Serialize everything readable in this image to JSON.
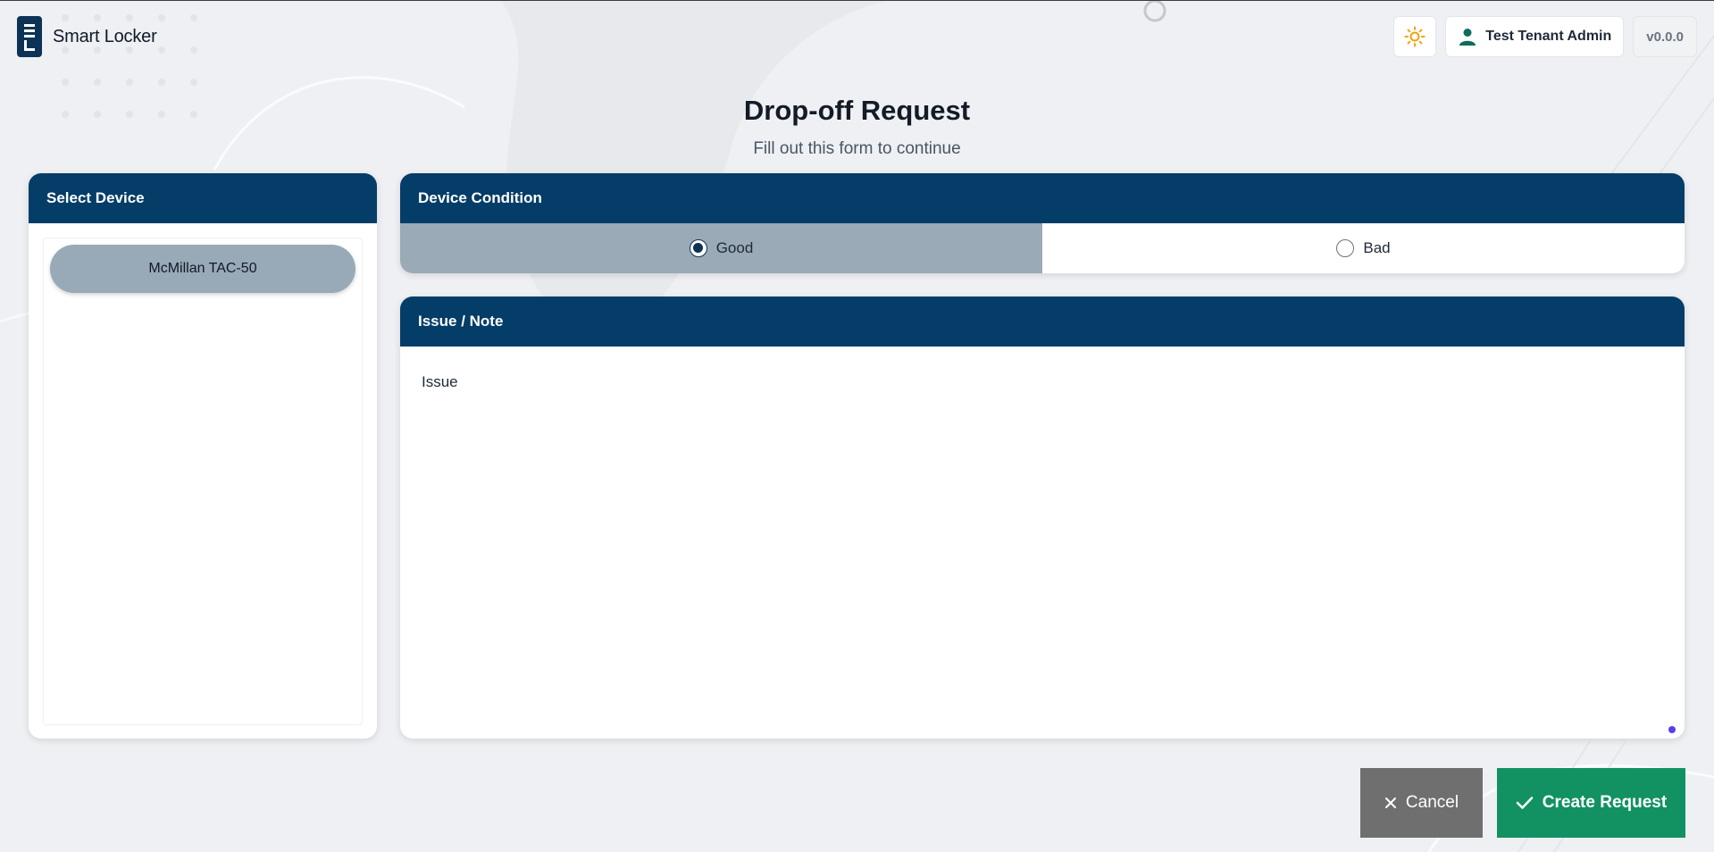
{
  "app": {
    "title": "Smart Locker"
  },
  "header": {
    "theme_icon": "sun-icon",
    "user_icon": "user-icon",
    "user_label": "Test Tenant Admin",
    "version": "v0.0.0"
  },
  "page": {
    "title": "Drop-off Request",
    "subtitle": "Fill out this form to continue"
  },
  "select_device": {
    "heading": "Select Device",
    "items": [
      {
        "label": "McMillan TAC-50",
        "selected": true
      }
    ]
  },
  "device_condition": {
    "heading": "Device Condition",
    "options": [
      {
        "label": "Good",
        "selected": true
      },
      {
        "label": "Bad",
        "selected": false
      }
    ]
  },
  "issue_note": {
    "heading": "Issue / Note",
    "value": "Issue"
  },
  "actions": {
    "cancel_label": "Cancel",
    "cancel_icon": "close-icon",
    "create_label": "Create Request",
    "create_icon": "check-icon"
  },
  "colors": {
    "primary": "#043d68",
    "selected": "#9aaab6",
    "success": "#129163",
    "neutral": "#6f6f6f",
    "sun": "#f0a30a"
  }
}
